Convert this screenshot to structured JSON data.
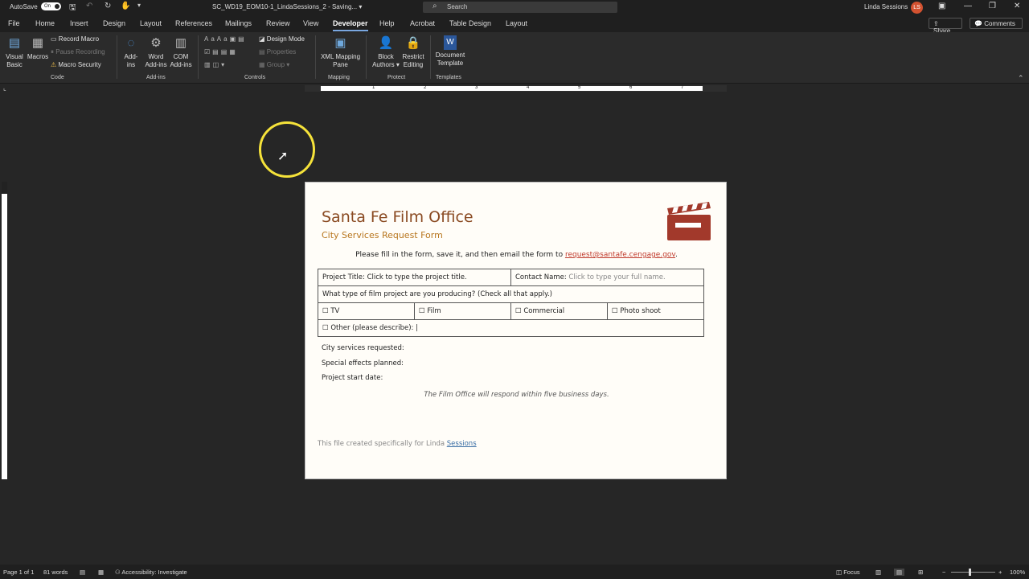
{
  "titlebar": {
    "autosave_label": "AutoSave",
    "autosave_state": "On",
    "document_title": "SC_WD19_EOM10-1_LindaSessions_2 - Saving... ▾",
    "search_placeholder": "Search",
    "user_name": "Linda Sessions",
    "user_initials": "LS"
  },
  "menu": {
    "tabs": [
      "File",
      "Home",
      "Insert",
      "Design",
      "Layout",
      "References",
      "Mailings",
      "Review",
      "View",
      "Developer",
      "Help",
      "Acrobat",
      "Table Design",
      "Layout"
    ],
    "active_tab": "Developer",
    "share_label": "Share",
    "comments_label": "Comments"
  },
  "ribbon": {
    "code": {
      "visual_basic": "Visual Basic",
      "visual_basic_l1": "Visual",
      "visual_basic_l2": "Basic",
      "macros": "Macros",
      "record_macro": "Record Macro",
      "pause_recording": "Pause Recording",
      "macro_security": "Macro Security",
      "group": "Code"
    },
    "addins": {
      "addins_l1": "Add-",
      "addins_l2": "ins",
      "word_l1": "Word",
      "word_l2": "Add-ins",
      "com_l1": "COM",
      "com_l2": "Add-ins",
      "group": "Add-ins"
    },
    "controls": {
      "design_mode": "Design Mode",
      "properties": "Properties",
      "group_btn": "Group ▾",
      "group": "Controls"
    },
    "mapping": {
      "xml_l1": "XML Mapping",
      "xml_l2": "Pane",
      "group": "Mapping"
    },
    "protect": {
      "block_l1": "Block",
      "block_l2": "Authors ▾",
      "restrict_l1": "Restrict",
      "restrict_l2": "Editing",
      "group": "Protect"
    },
    "templates": {
      "doc_l1": "Document",
      "doc_l2": "Template",
      "group": "Templates"
    }
  },
  "ruler": {
    "numbers": [
      "1",
      "2",
      "3",
      "4",
      "5",
      "6",
      "7"
    ]
  },
  "document": {
    "title": "Santa Fe Film Office",
    "subtitle": "City Services Request Form",
    "instructions_prefix": "Please fill in the form, save it, and then email the form to ",
    "email": "request@santafe.cengage.gov",
    "instructions_suffix": ".",
    "project_title_label": "Project Title: ",
    "project_title_placeholder": "Click to type the project title.",
    "contact_label": "Contact Name: ",
    "contact_placeholder": "Click to type your full name.",
    "question": "What type of film project are you producing? (Check all that apply.)",
    "options": [
      "☐ TV",
      "☐ Film",
      "☐ Commercial",
      "☐ Photo shoot"
    ],
    "other": "☐ Other (please describe): |",
    "city_services": "City services requested:",
    "special_effects": "Special effects planned:",
    "start_date": "Project start date:",
    "note": "The Film Office will respond within five business days.",
    "footer_prefix": "This file created specifically for Linda ",
    "footer_name": "Sessions"
  },
  "status": {
    "page": "Page 1 of 1",
    "words": "81 words",
    "accessibility": "Accessibility: Investigate",
    "focus": "Focus",
    "zoom": "100%"
  },
  "colors": {
    "title": "#8a4a22",
    "subtitle": "#b8761e",
    "accent": "#7aa7e0",
    "cursor_highlight": "#f5e23a"
  }
}
